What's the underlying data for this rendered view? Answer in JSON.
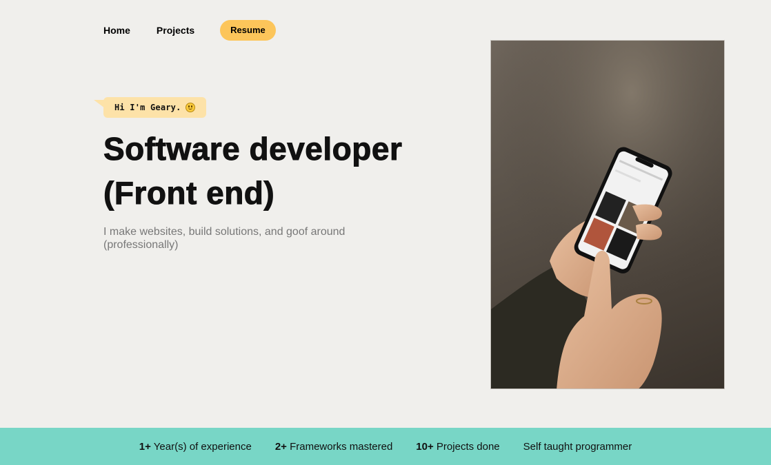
{
  "nav": {
    "home": "Home",
    "projects": "Projects",
    "resume": "Resume"
  },
  "hero": {
    "greeting": "Hi I'm Geary.",
    "greeting_emoji": "smile-emoji",
    "title_line1": "Software developer",
    "title_line2": "(Front end)",
    "subtitle": "I make websites, build solutions, and goof around (professionally)"
  },
  "photo": {
    "description_icon": "phone-in-hand-photo"
  },
  "stats": [
    {
      "value": "1+",
      "label": "Year(s) of experience"
    },
    {
      "value": "2+",
      "label": "Frameworks mastered"
    },
    {
      "value": "10+",
      "label": "Projects done"
    },
    {
      "value": "",
      "label": "Self taught programmer"
    }
  ],
  "colors": {
    "background": "#f0efec",
    "accent_yellow": "#fcc55a",
    "greeting_bg": "#fde2a8",
    "stats_bg": "#78d6c6"
  }
}
